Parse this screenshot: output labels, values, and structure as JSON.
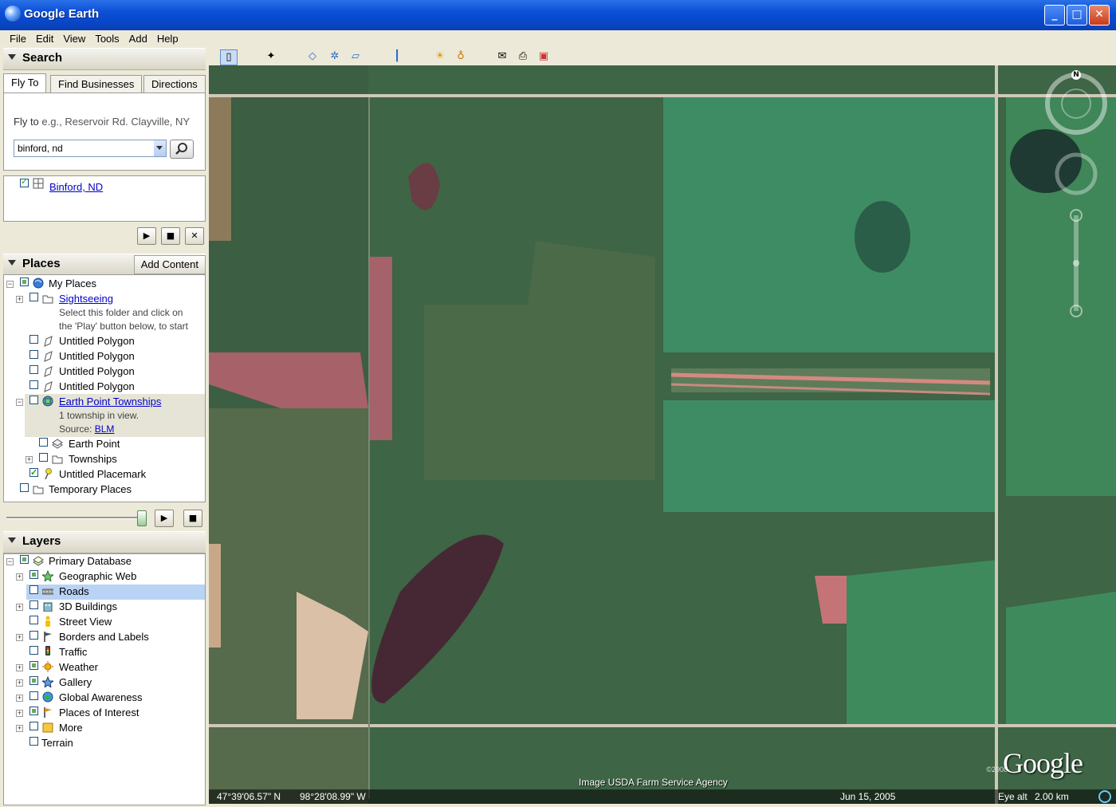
{
  "window": {
    "title": "Google Earth",
    "minimize": "_",
    "maximize": "□",
    "close": "✕"
  },
  "menu": [
    "File",
    "Edit",
    "View",
    "Tools",
    "Add",
    "Help"
  ],
  "search": {
    "header": "Search",
    "tabs": [
      "Fly To",
      "Find Businesses",
      "Directions"
    ],
    "flyto_label": "Fly to",
    "flyto_hint": "e.g., Reservoir Rd. Clayville, NY",
    "input_value": "binford, nd",
    "result": "Binford, ND"
  },
  "places": {
    "header": "Places",
    "add_content": "Add Content",
    "items": [
      {
        "label": "My Places"
      },
      {
        "label": "Sightseeing"
      },
      {
        "label": "Select this folder and click on"
      },
      {
        "label": "the 'Play' button below, to start"
      },
      {
        "label": "Untitled Polygon"
      },
      {
        "label": "Untitled Polygon"
      },
      {
        "label": "Untitled Polygon"
      },
      {
        "label": "Untitled Polygon"
      },
      {
        "label": "Earth Point Townships"
      },
      {
        "label": "1 township in view."
      },
      {
        "label": "Source:"
      },
      {
        "label": "BLM"
      },
      {
        "label": "Earth Point"
      },
      {
        "label": "Townships"
      },
      {
        "label": "Untitled Placemark"
      },
      {
        "label": "Temporary Places"
      }
    ]
  },
  "layers": {
    "header": "Layers",
    "items": [
      {
        "label": "Primary Database"
      },
      {
        "label": "Geographic Web"
      },
      {
        "label": "Roads"
      },
      {
        "label": "3D Buildings"
      },
      {
        "label": "Street View"
      },
      {
        "label": "Borders and Labels"
      },
      {
        "label": "Traffic"
      },
      {
        "label": "Weather"
      },
      {
        "label": "Gallery"
      },
      {
        "label": "Global Awareness"
      },
      {
        "label": "Places of Interest"
      },
      {
        "label": "More"
      },
      {
        "label": "Terrain"
      }
    ]
  },
  "map": {
    "attribution": "Image USDA Farm Service Agency",
    "copyright": "©2008",
    "logo": "Google",
    "compass_n": "N",
    "status": {
      "lat": "47°39'06.57\" N",
      "lon": "98°28'08.99\" W",
      "date": "Jun 15, 2005",
      "eye_alt_label": "Eye alt",
      "eye_alt_value": "2.00 km"
    }
  },
  "icons": {
    "play": "▶",
    "stop": "■",
    "close": "✕",
    "search": "🔍"
  }
}
